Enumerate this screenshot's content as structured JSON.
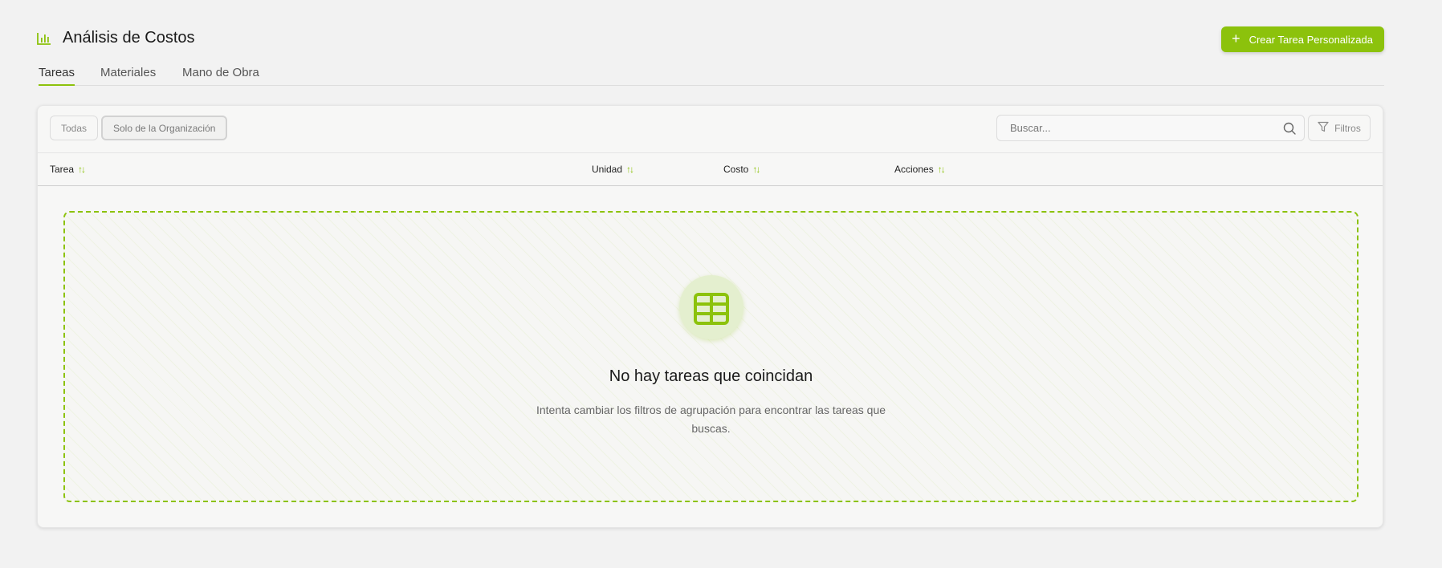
{
  "header": {
    "title": "Análisis de Costos",
    "create_button": "Crear Tarea Personalizada",
    "title_icon": "bar-chart-icon"
  },
  "tabs": [
    {
      "label": "Tareas",
      "active": true
    },
    {
      "label": "Materiales",
      "active": false
    },
    {
      "label": "Mano de Obra",
      "active": false
    }
  ],
  "toolbar": {
    "all_label": "Todas",
    "org_label": "Solo de la Organización",
    "search_placeholder": "Buscar...",
    "filters_label": "Filtros"
  },
  "table": {
    "columns": [
      "Tarea",
      "Unidad",
      "Costo",
      "Acciones"
    ]
  },
  "empty_state": {
    "title": "No hay tareas que coincidan",
    "description": "Intenta cambiar los filtros de agrupación para encontrar las tareas que buscas.",
    "icon": "table-icon"
  },
  "colors": {
    "accent": "#8cc20c",
    "background": "#f2f2f2"
  }
}
